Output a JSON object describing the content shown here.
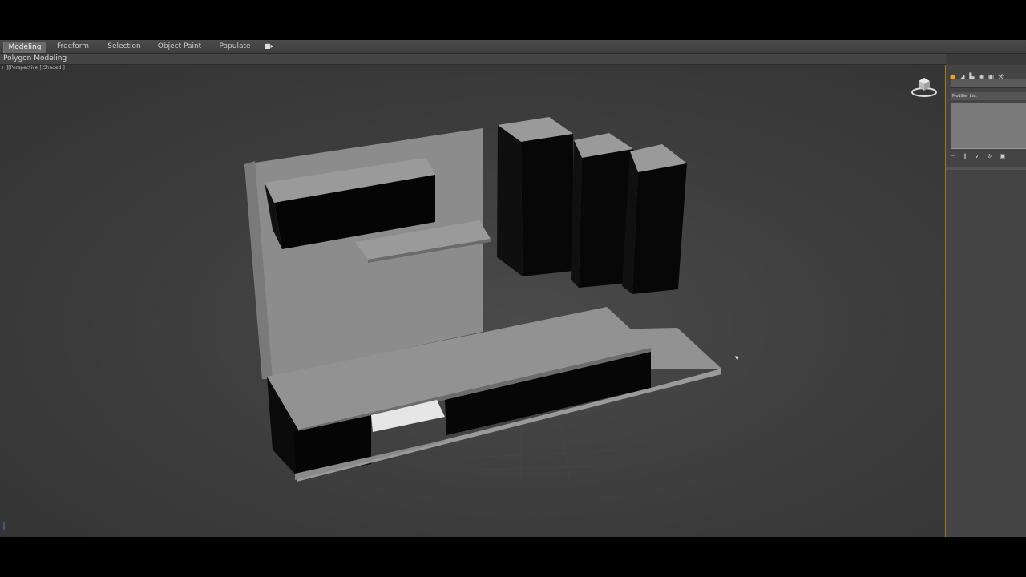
{
  "ribbon": {
    "tabs": [
      {
        "label": "Modeling",
        "active": true
      },
      {
        "label": "Freeform",
        "active": false
      },
      {
        "label": "Selection",
        "active": false
      },
      {
        "label": "Object Paint",
        "active": false
      },
      {
        "label": "Populate",
        "active": false
      }
    ],
    "extra_icon": "video-camera-icon",
    "sub_label": "Polygon Modeling"
  },
  "viewport": {
    "label": "+ ][Perspective ][Shaded ]"
  },
  "command_panel": {
    "tab_icons": [
      "sun-icon",
      "modify-icon",
      "hierarchy-icon",
      "motion-icon",
      "display-icon",
      "utilities-icon"
    ],
    "modifier_list_label": "Modifier List"
  },
  "colors": {
    "accent": "#a07a20",
    "surface": "#8a8a8a",
    "cabinet": "#000000"
  }
}
